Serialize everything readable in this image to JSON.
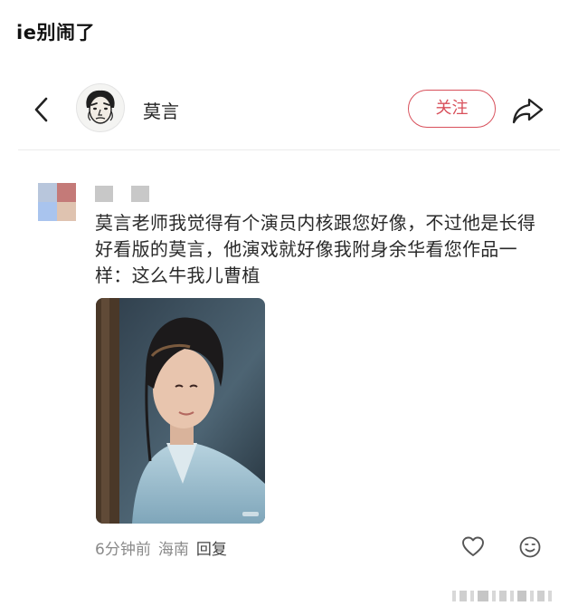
{
  "caption": "ie别闹了",
  "header": {
    "user_name": "莫言",
    "follow_label": "关注"
  },
  "comment": {
    "text": "莫言老师我觉得有个演员内核跟您好像，不过他是长得好看版的莫言，他演戏就好像我附身余华看您作品一样：这么牛我儿曹植",
    "time": "6分钟前",
    "location": "海南",
    "reply_label": "回复"
  },
  "colors": {
    "accent": "#d8505b",
    "avatar_squares": [
      "#b8c6dc",
      "#c47a78",
      "#a9c4ee",
      "#dfc3b0"
    ]
  },
  "icons": {
    "back": "chevron-left",
    "share": "share-arrow",
    "like": "heart-outline",
    "emoji": "smiley-outline"
  }
}
